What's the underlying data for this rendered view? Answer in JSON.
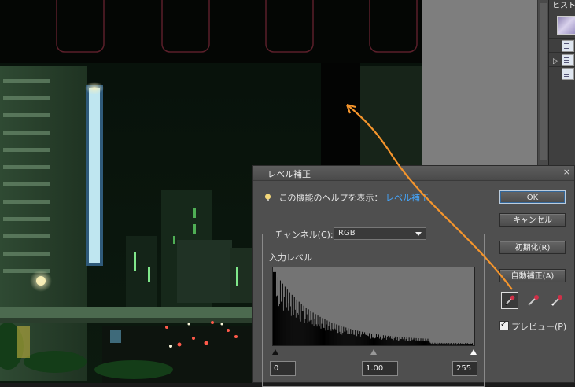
{
  "history_panel": {
    "tab_label": "ヒストリ"
  },
  "dialog": {
    "title": "レベル補正",
    "close_glyph": "×",
    "help_text": "この機能のヘルプを表示：",
    "help_link": "レベル補正",
    "buttons": {
      "ok": "OK",
      "cancel": "キャンセル",
      "reset": "初期化(R)",
      "auto": "自動補正(A)"
    },
    "channel_label": "チャンネル(C):",
    "channel_value": "RGB",
    "input_levels_label": "入力レベル",
    "input_levels": {
      "black": "0",
      "gamma": "1.00",
      "white": "255"
    },
    "preview_label": "プレビュー(P)",
    "preview_checked": true
  },
  "colors": {
    "link": "#44a7ff",
    "annotation_arrow": "#f5952c"
  }
}
